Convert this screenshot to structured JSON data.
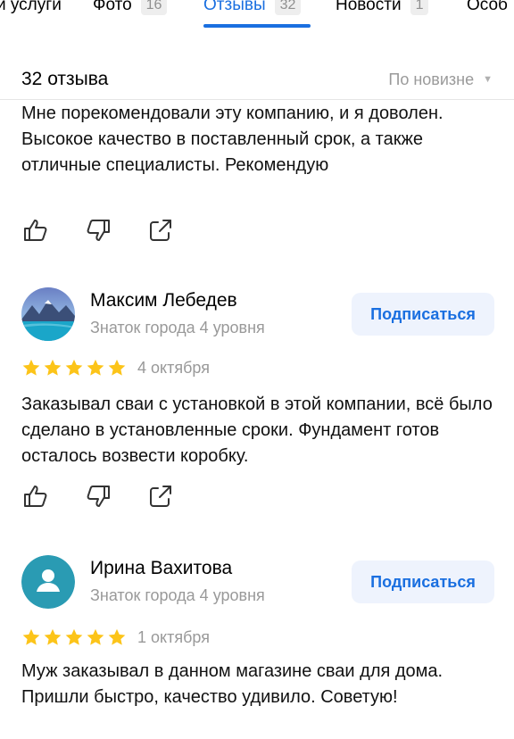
{
  "tabs": [
    {
      "label": "и услуги",
      "count": "",
      "active": false
    },
    {
      "label": "Фото",
      "count": "16",
      "active": false
    },
    {
      "label": "Отзывы",
      "count": "32",
      "active": true
    },
    {
      "label": "Новости",
      "count": "1",
      "active": false
    },
    {
      "label": "Особ",
      "count": "",
      "active": false
    }
  ],
  "header": {
    "count_label": "32 отзыва",
    "sort_label": "По новизне"
  },
  "reviews": [
    {
      "text": "Мне порекомендовали эту компанию, и я доволен. Высокое качество в поставленный срок, а также отличные специалисты. Рекомендую"
    },
    {
      "author": "Максим Лебедев",
      "level": "Знаток города 4 уровня",
      "subscribe_label": "Подписаться",
      "stars": 5,
      "date": "4 октября",
      "text": "Заказывал сваи с установкой в этой компании, всё было  сделано в установленные сроки. Фундамент готов осталось возвести коробку."
    },
    {
      "author": "Ирина Вахитова",
      "level": "Знаток города 4 уровня",
      "subscribe_label": "Подписаться",
      "stars": 5,
      "date": "1 октября",
      "text": "Муж заказывал в данном магазине сваи для дома. Пришли быстро, качество удивило. Советую!"
    }
  ],
  "colors": {
    "accent": "#1a6fe0",
    "star": "#fcc419",
    "muted": "#999999",
    "avatar_teal": "#2a9bb3"
  },
  "icons": [
    "thumbs-up-icon",
    "thumbs-down-icon",
    "share-icon",
    "star-icon",
    "user-icon"
  ]
}
